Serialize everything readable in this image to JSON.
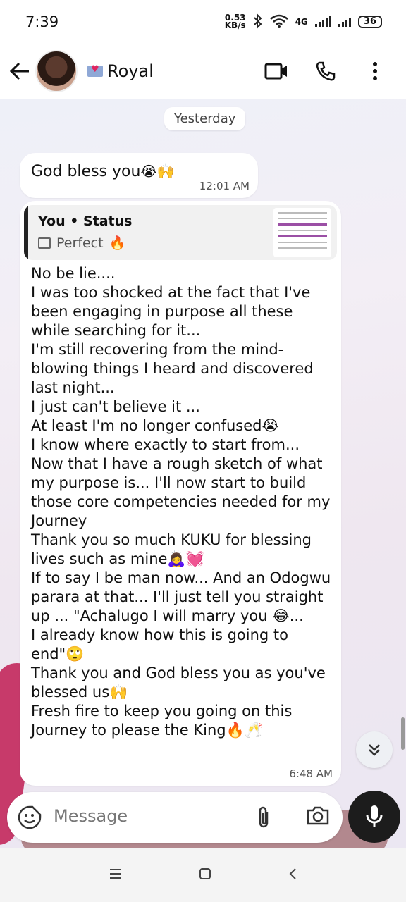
{
  "status_bar": {
    "time": "7:39",
    "net_speed_value": "0.53",
    "net_speed_unit": "KB/s",
    "network_label": "4G",
    "battery": "36"
  },
  "header": {
    "contact_name": "Royal",
    "icons": [
      "back-arrow-icon",
      "video-call-icon",
      "voice-call-icon",
      "more-options-icon"
    ]
  },
  "chat": {
    "date_separator": "Yesterday",
    "messages": [
      {
        "text": "God bless you",
        "emojis": "😭🙌",
        "time": "12:01 AM"
      },
      {
        "quote": {
          "title": "You • Status",
          "subtitle": "Perfect",
          "subtitle_emoji": "🔥"
        },
        "text": "No be lie....\nI was too shocked at the fact that I've been engaging in purpose all these while searching for it...\nI'm still recovering from the mind-blowing things I heard and discovered last night...\nI just can't believe it ...\nAt least I'm no longer confused😭\nI know where exactly to start from...\nNow that I have a rough sketch of what my purpose is... I'll now start to build those core competencies needed for my Journey\nThank you so much KUKU for blessing lives such as mine🙇‍♀️💓\nIf to say I be man now... And an Odogwu parara at that... I'll just tell you straight up ... \"Achalugo I will marry you 😂...\nI already know how this is going to end\"🙄\nThank you and God bless you as you've blessed us🙌\nFresh fire to keep you going on this Journey to please the King🔥🥂",
        "time": "6:48 AM"
      }
    ]
  },
  "composer": {
    "placeholder": "Message"
  },
  "colors": {
    "mic_button": "#1c1c1c",
    "bubble": "#ffffff",
    "chat_background": "#eef0f8"
  }
}
